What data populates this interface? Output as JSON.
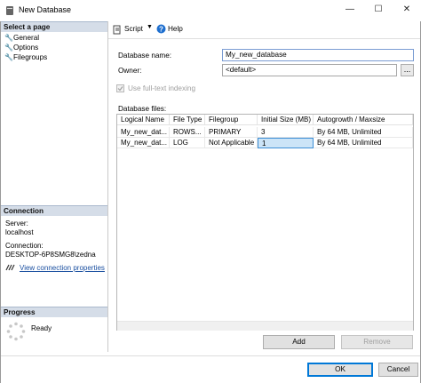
{
  "window": {
    "title": "New Database",
    "controls": [
      "—",
      "☐",
      "✕"
    ]
  },
  "left": {
    "select_page_header": "Select a page",
    "pages": [
      {
        "label": "General"
      },
      {
        "label": "Options"
      },
      {
        "label": "Filegroups"
      }
    ],
    "connection_header": "Connection",
    "server_label": "Server:",
    "server_value": "localhost",
    "connection_label": "Connection:",
    "connection_value": "DESKTOP-6P8SMG8\\zedna",
    "view_props_link": "View connection properties",
    "progress_header": "Progress",
    "progress_status": "Ready"
  },
  "toolbar": {
    "script_label": "Script",
    "help_label": "Help"
  },
  "form": {
    "dbname_label": "Database name:",
    "dbname_value": "My_new_database",
    "owner_label": "Owner:",
    "owner_value": "<default>",
    "owner_browse": "...",
    "fulltext_label": "Use full-text indexing",
    "files_label": "Database files:"
  },
  "grid": {
    "columns": [
      "Logical Name",
      "File Type",
      "Filegroup",
      "Initial Size (MB)",
      "Autogrowth / Maxsize"
    ],
    "rows": [
      [
        "My_new_dat...",
        "ROWS...",
        "PRIMARY",
        "3",
        "By 64 MB, Unlimited"
      ],
      [
        "My_new_dat...",
        "LOG",
        "Not Applicable",
        "1",
        "By 64 MB, Unlimited"
      ]
    ]
  },
  "buttons": {
    "add": "Add",
    "remove": "Remove",
    "ok": "OK",
    "cancel": "Cancel"
  },
  "colors": {
    "accent": "#0078d7",
    "selection": "#cce4f7",
    "header_band": "#d5dde8",
    "link": "#1a4fa0"
  }
}
